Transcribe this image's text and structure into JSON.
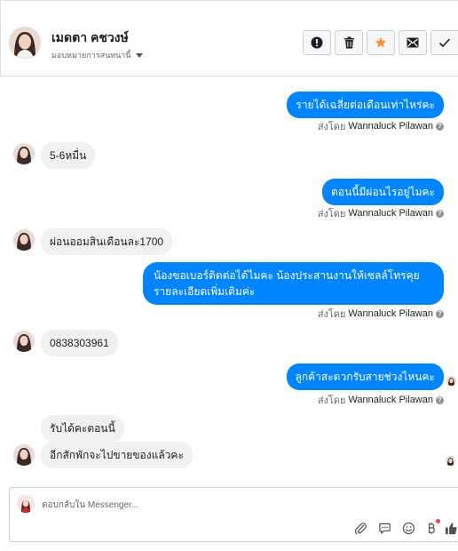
{
  "contact": {
    "name": "เมดตา คชวงษ์",
    "assign_label": "มอบหมายการสนทนานี้"
  },
  "actions": [
    {
      "icon": "report-icon",
      "label": "Report"
    },
    {
      "icon": "trash-icon",
      "label": "Delete"
    },
    {
      "icon": "star-icon",
      "label": "Star"
    },
    {
      "icon": "mark-unread-icon",
      "label": "Mark unread"
    },
    {
      "icon": "checkmark-icon",
      "label": "Done"
    }
  ],
  "colors": {
    "accent": "#0084ff",
    "star": "#f7923b",
    "incoming_bubble": "#f1f0f0",
    "border": "#dddfe2"
  },
  "messages": [
    {
      "dir": "out",
      "text": "รายได้เฉลี่ยต่อเดือนเท่าไหร่คะ",
      "sent_by_label": "ส่งโดย",
      "sender": "Wannaluck Pilawan"
    },
    {
      "dir": "in",
      "text": "5-6หมื่น"
    },
    {
      "dir": "out",
      "text": "ตอนนี้มีผ่อนไรอยู่ไมคะ",
      "sent_by_label": "ส่งโดย",
      "sender": "Wannaluck Pilawan"
    },
    {
      "dir": "in",
      "text": "ผ่อนออมสินเดือนละ1700"
    },
    {
      "dir": "out",
      "text": "น้องขอเบอร์ติดต่อได้ไมคะ น้องประสานงานให้เซลล์โทรคุยรายละเอียดเพิ่มเติมค่ะ",
      "sent_by_label": "ส่งโดย",
      "sender": "Wannaluck Pilawan"
    },
    {
      "dir": "in",
      "text": "0838303961"
    },
    {
      "dir": "out",
      "text": "ลูกค้าสะดวกรับสายช่วงไหนคะ",
      "sent_by_label": "ส่งโดย",
      "sender": "Wannaluck Pilawan"
    },
    {
      "dir": "in",
      "text": "รับได้คะตอนนี้"
    },
    {
      "dir": "in",
      "text": "อีกสักพักจะไปขายของแล้วคะ"
    }
  ],
  "composer": {
    "placeholder": "ตอบกลับใน Messenger...",
    "icons": [
      "attachment-icon",
      "saved-reply-icon",
      "emoji-icon",
      "payment-icon",
      "like-icon"
    ]
  }
}
